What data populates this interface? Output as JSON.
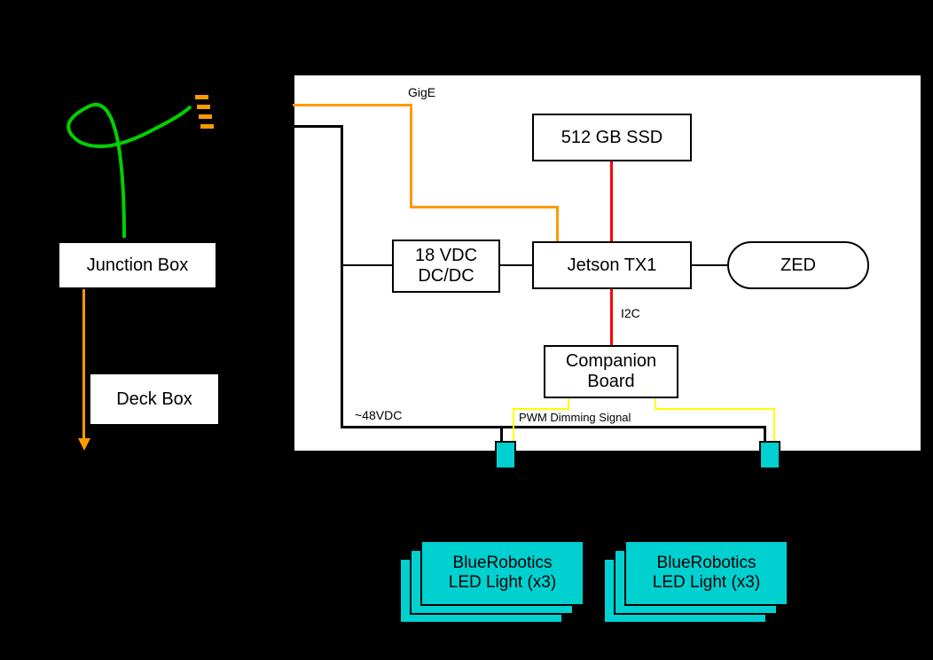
{
  "diagram": {
    "junction_box": "Junction Box",
    "deck_box": "Deck Box",
    "ssd": "512 GB SSD",
    "dcdc": "18 VDC\nDC/DC",
    "jetson": "Jetson TX1",
    "zed": "ZED",
    "companion": "Companion\nBoard",
    "gige": "GigE",
    "i2c": "I2C",
    "v48": "~48VDC",
    "pwm": "PWM Dimming Signal",
    "led_left": "BlueRobotics\nLED Light (x3)",
    "led_right": "BlueRobotics\nLED Light (x3)"
  }
}
